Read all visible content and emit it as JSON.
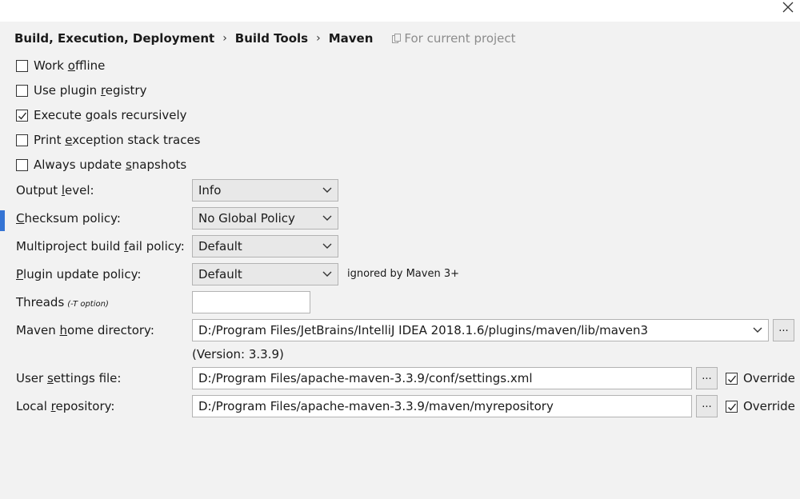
{
  "breadcrumb": {
    "items": [
      "Build, Execution, Deployment",
      "Build Tools",
      "Maven"
    ],
    "separator": "›",
    "scope_label": "For current project"
  },
  "checkboxes": [
    {
      "pre": "Work ",
      "ul": "o",
      "post": "ffline",
      "checked": false
    },
    {
      "pre": "Use plugin ",
      "ul": "r",
      "post": "egistry",
      "checked": false
    },
    {
      "pre": "Execute ",
      "ul": "g",
      "post": "oals recursively",
      "checked": true
    },
    {
      "pre": "Print ",
      "ul": "e",
      "post": "xception stack traces",
      "checked": false
    },
    {
      "pre": "Always update ",
      "ul": "s",
      "post": "napshots",
      "checked": false
    }
  ],
  "fields": {
    "output_level": {
      "pre": "Output ",
      "ul": "l",
      "post": "evel:",
      "value": "Info"
    },
    "checksum_policy": {
      "pre": "",
      "ul": "C",
      "post": "hecksum policy:",
      "value": "No Global Policy"
    },
    "multiproject": {
      "pre": "Multiproject build ",
      "ul": "f",
      "post": "ail policy:",
      "value": "Default"
    },
    "plugin_update": {
      "pre": "",
      "ul": "P",
      "post": "lugin update policy:",
      "value": "Default",
      "hint": "ignored by Maven 3+"
    },
    "threads": {
      "label": "Threads",
      "note": "(-T option)",
      "value": ""
    },
    "maven_home": {
      "pre": "Maven ",
      "ul": "h",
      "post": "ome directory:",
      "value": "D:/Program Files/JetBrains/IntelliJ IDEA 2018.1.6/plugins/maven/lib/maven3",
      "version": "(Version: 3.3.9)"
    },
    "user_settings": {
      "pre": "User ",
      "ul": "s",
      "post": "ettings file:",
      "value": "D:/Program Files/apache-maven-3.3.9/conf/settings.xml",
      "override_label": "Override",
      "override_checked": true
    },
    "local_repo": {
      "pre": "Local ",
      "ul": "r",
      "post": "epository:",
      "value": "D:/Program Files/apache-maven-3.3.9/maven/myrepository",
      "override_label": "Override",
      "override_checked": true
    }
  },
  "browse_label": "...",
  "colors": {
    "accent": "#3574d4",
    "background": "#f2f2f2"
  },
  "icons": {
    "close": "close-icon",
    "scope": "project-scope-icon",
    "dropdown": "chevron-down-icon",
    "check": "checkmark-icon"
  }
}
